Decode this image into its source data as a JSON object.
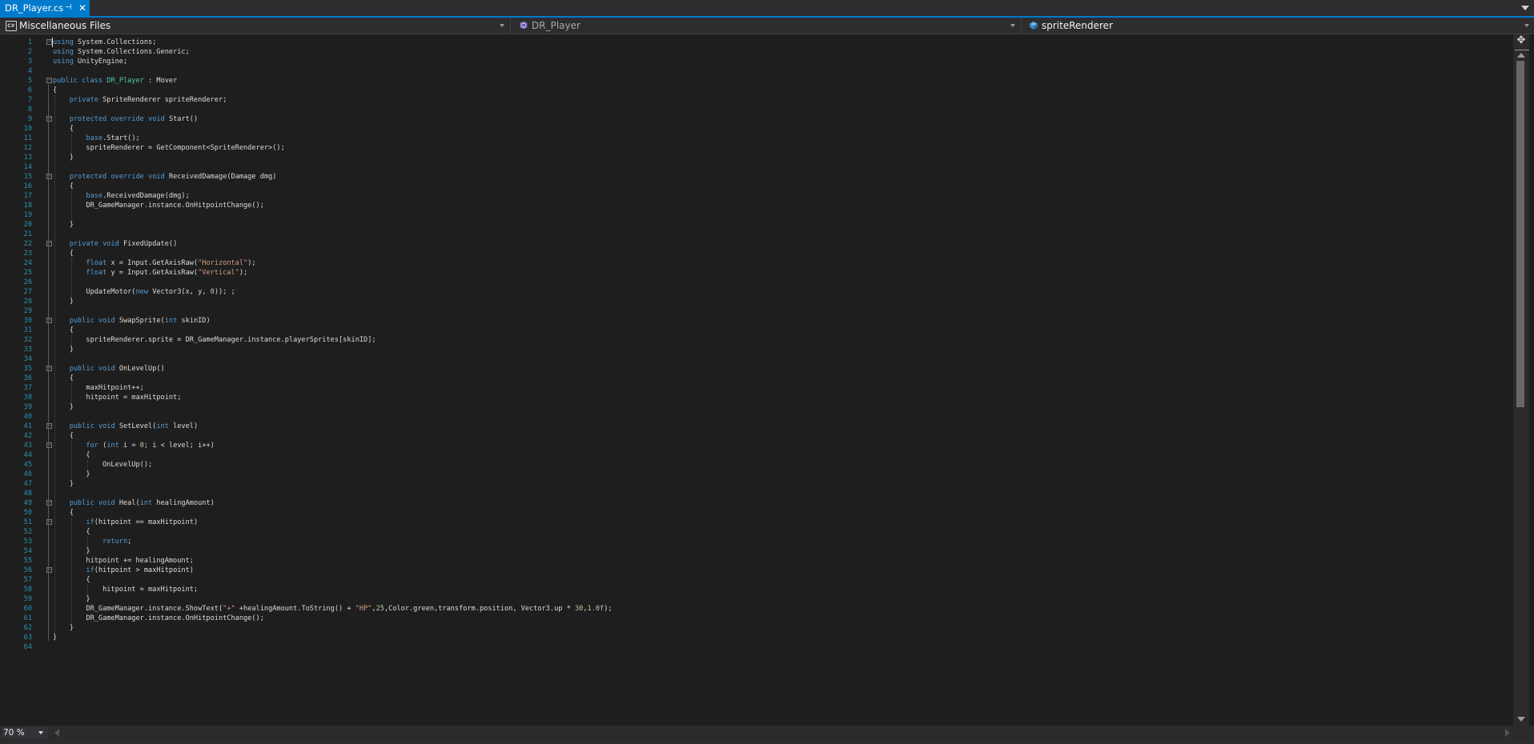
{
  "tab": {
    "title": "DR_Player.cs",
    "pin_glyph": "⊣",
    "close_glyph": "✕"
  },
  "nav": {
    "project": "Miscellaneous Files",
    "project_icon": "csharp-file-icon",
    "type": "DR_Player",
    "type_icon": "class-icon",
    "member": "spriteRenderer",
    "member_icon": "field-icon"
  },
  "editor": {
    "lines": [
      "using System.Collections;",
      "using System.Collections.Generic;",
      "using UnityEngine;",
      "",
      "public class DR_Player : Mover",
      "{",
      "    private SpriteRenderer spriteRenderer;",
      "",
      "    protected override void Start()",
      "    {",
      "        base.Start();",
      "        spriteRenderer = GetComponent<SpriteRenderer>();",
      "    }",
      "",
      "    protected override void ReceivedDamage(Damage dmg)",
      "    {",
      "        base.ReceivedDamage(dmg);",
      "        DR_GameManager.instance.OnHitpointChange();",
      "",
      "    }",
      "",
      "    private void FixedUpdate()",
      "    {",
      "        float x = Input.GetAxisRaw(\"Horizontal\");",
      "        float y = Input.GetAxisRaw(\"Vertical\");",
      "",
      "        UpdateMotor(new Vector3(x, y, 0)); ;",
      "    }",
      "",
      "    public void SwapSprite(int skinID)",
      "    {",
      "        spriteRenderer.sprite = DR_GameManager.instance.playerSprites[skinID];",
      "    }",
      "",
      "    public void OnLevelUp()",
      "    {",
      "        maxHitpoint++;",
      "        hitpoint = maxHitpoint;",
      "    }",
      "",
      "    public void SetLevel(int level)",
      "    {",
      "        for (int i = 0; i < level; i++)",
      "        {",
      "            OnLevelUp();",
      "        }",
      "    }",
      "",
      "    public void Heal(int healingAmount)",
      "    {",
      "        if(hitpoint == maxHitpoint)",
      "        {",
      "            return;",
      "        }",
      "        hitpoint += healingAmount;",
      "        if(hitpoint > maxHitpoint)",
      "        {",
      "            hitpoint = maxHitpoint;",
      "        }",
      "        DR_GameManager.instance.ShowText(\"+\" +healingAmount.ToString() + \"HP\",25,Color.green,transform.position, Vector3.up * 30,1.0f);",
      "        DR_GameManager.instance.OnHitpointChange();",
      "    }",
      "}",
      ""
    ],
    "folded_lines": [
      1,
      5,
      9,
      15,
      22,
      30,
      35,
      41,
      43,
      49,
      51,
      56
    ],
    "caret_line": 1
  },
  "statusbar": {
    "zoom": "70 %"
  },
  "colors": {
    "accent": "#007acc",
    "background": "#1e1e1e",
    "keyword": "#569cd6",
    "type": "#4ec9b0",
    "string": "#d69d85",
    "number": "#b5cea8",
    "line_number": "#2b91af"
  }
}
